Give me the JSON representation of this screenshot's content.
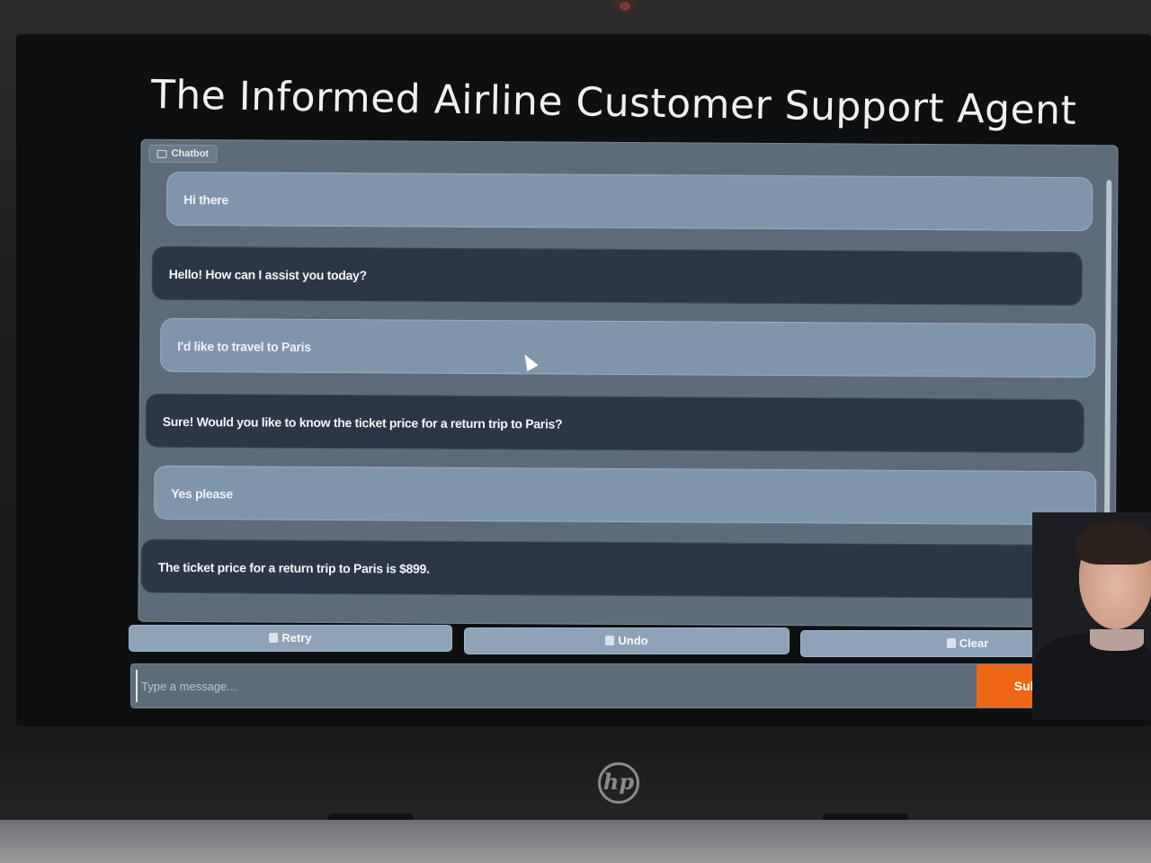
{
  "app": {
    "title": "The Informed Airline Customer Support Agent"
  },
  "chatbot": {
    "label": "Chatbot",
    "messages": [
      {
        "role": "user",
        "text": "Hi there"
      },
      {
        "role": "bot",
        "text": "Hello! How can I assist you today?"
      },
      {
        "role": "user",
        "text": "I'd like to travel to Paris"
      },
      {
        "role": "bot",
        "text": "Sure! Would you like to know the ticket price for a return trip to Paris?"
      },
      {
        "role": "user",
        "text": "Yes please"
      },
      {
        "role": "bot",
        "text": "The ticket price for a return trip to Paris is $899."
      }
    ]
  },
  "actions": {
    "retry_label": "Retry",
    "undo_label": "Undo",
    "clear_label": "Clear"
  },
  "composer": {
    "placeholder": "Type a message...",
    "value": "",
    "submit_label": "Sub"
  },
  "device": {
    "brand": "hp"
  },
  "colors": {
    "submit": "#ee6716",
    "user_bubble": "#7f95aa",
    "bot_bubble": "#2b3744",
    "panel": "#5d6c7b"
  }
}
